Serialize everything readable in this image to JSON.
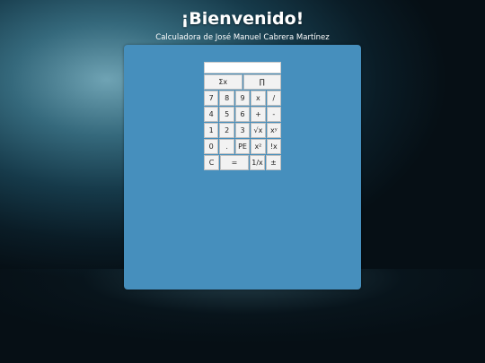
{
  "header": {
    "title": "¡Bienvenido!",
    "subtitle": "Calculadora de José Manuel Cabrera Martínez"
  },
  "calculator": {
    "display": "",
    "keys": {
      "sum": "Σx",
      "product": "∏",
      "k7": "7",
      "k8": "8",
      "k9": "9",
      "mul": "x",
      "div": "/",
      "k4": "4",
      "k5": "5",
      "k6": "6",
      "add": "+",
      "sub": "-",
      "k1": "1",
      "k2": "2",
      "k3": "3",
      "sqrt": "√x",
      "pow": "xʸ",
      "k0": "0",
      "dot": ".",
      "pe": "PE",
      "sq": "x²",
      "fact": "!x",
      "clear": "C",
      "eq": "=",
      "inv": "1/x",
      "sign": "±"
    }
  },
  "colors": {
    "panel": "#468fbd",
    "key_bg": "#f2f2f2"
  }
}
